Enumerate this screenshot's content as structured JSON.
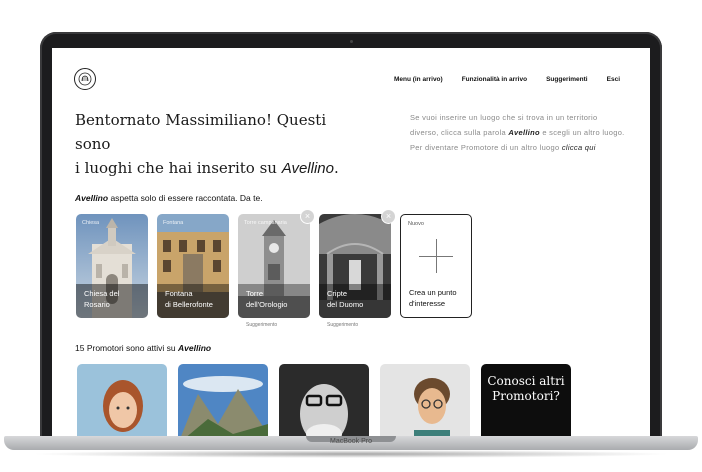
{
  "device": {
    "label": "MacBook Pro"
  },
  "nav": {
    "items": [
      "Menu (in arrivo)",
      "Funzionalità in arrivo",
      "Suggerimenti",
      "Esci"
    ]
  },
  "headline": {
    "line1": "Bentornato Massimiliano! Questi sono",
    "line2": "i luoghi che hai inserito su",
    "city": "Avellino",
    "end": "."
  },
  "intro": {
    "part1": "Se vuoi inserire un luogo che si trova in un territorio diverso, clicca sulla parola",
    "city": "Avellino",
    "part2": "e scegli un altro luogo. Per diventare Promotore di un altro luogo",
    "link": "clicca qui"
  },
  "places_section": {
    "city": "Avellino",
    "text": "aspetta solo di essere raccontata. Da te."
  },
  "places": [
    {
      "tag": "Chiesa",
      "line1": "Chiesa del",
      "line2": "Rosario",
      "suggestion": "",
      "closable": false
    },
    {
      "tag": "Fontana",
      "line1": "Fontana",
      "line2": "di Bellerofonte",
      "suggestion": "",
      "closable": false
    },
    {
      "tag": "Torre campanaria",
      "line1": "Torre",
      "line2": "dell'Orologio",
      "suggestion": "Suggerimento",
      "closable": true
    },
    {
      "tag": "",
      "line1": "Cripte",
      "line2": "del Duomo",
      "suggestion": "Suggerimento",
      "closable": true
    }
  ],
  "new_place": {
    "tag": "Nuovo",
    "line1": "Crea un punto",
    "line2": "d'interesse"
  },
  "promoters_section": {
    "text": "15 Promotori sono attivi su",
    "city": "Avellino"
  },
  "promoters_cta": {
    "line1": "Conosci altri",
    "line2": "Promotori?"
  },
  "colors": {
    "accent": "#111111",
    "muted_text": "#8a8a8a",
    "card_border": "#222222"
  }
}
